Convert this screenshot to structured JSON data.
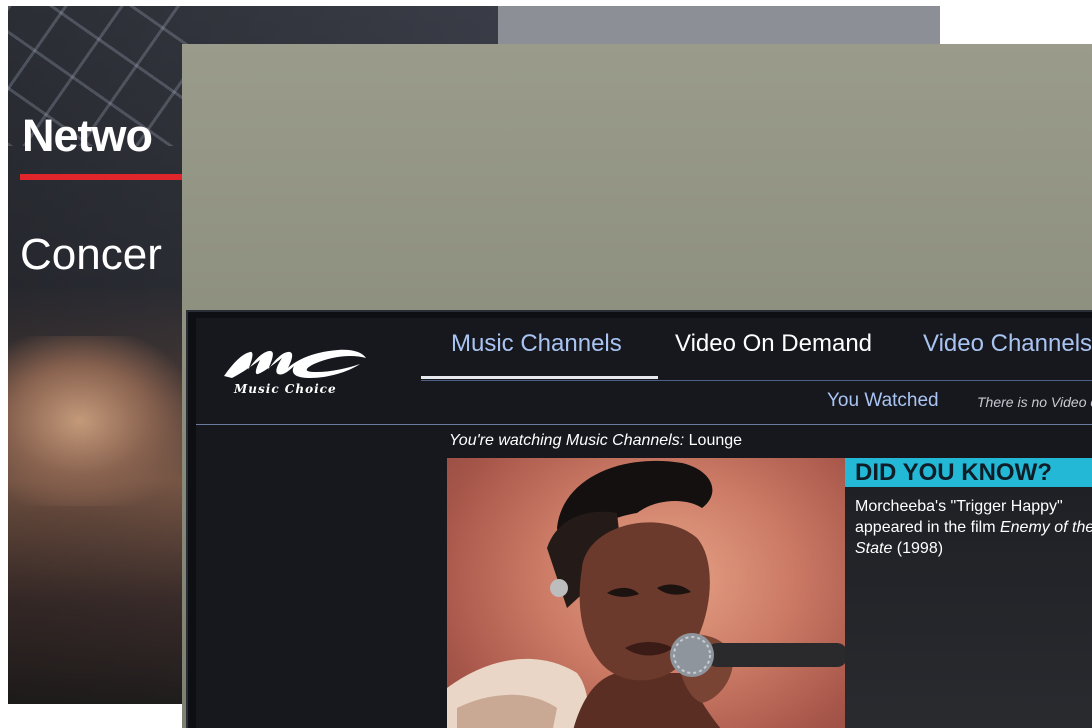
{
  "back_screen": {
    "title": "Netwo",
    "item": "Concer"
  },
  "app": {
    "logo_text": "Music Choice",
    "accent_color": "#23b8d6",
    "link_color": "#a9c4f3"
  },
  "nav": {
    "tabs": [
      {
        "label": "Music Channels",
        "selected": true
      },
      {
        "label": "Video On Demand",
        "selected": false
      },
      {
        "label": "Video Channels",
        "selected": false
      }
    ],
    "sub_items": {
      "you_watched": "You Watched",
      "no_video": "There is no Video o"
    }
  },
  "now_playing": {
    "prefix": "You're watching Music Channels:",
    "channel": "Lounge"
  },
  "did_you_know": {
    "heading": "DID YOU KNOW?",
    "text_before": "Morcheeba's \"Trigger Happy\" appeared in the film ",
    "film": "Enemy of the State",
    "text_after": " (1998)"
  }
}
